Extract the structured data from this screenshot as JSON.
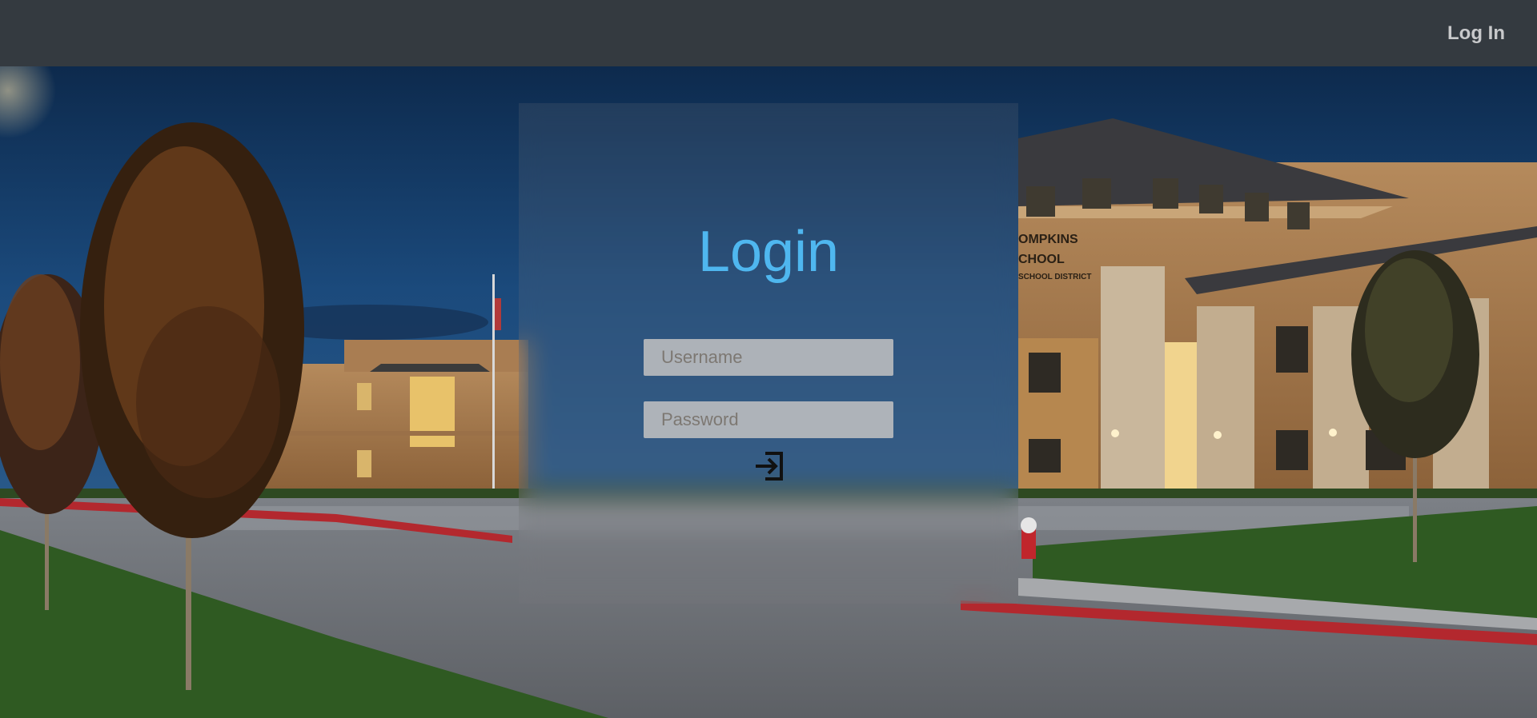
{
  "navbar": {
    "login_link": "Log In"
  },
  "background": {
    "building_sign": [
      "OMPKINS",
      "CHOOL",
      "SCHOOL DISTRICT"
    ]
  },
  "login_form": {
    "title": "Login",
    "username_placeholder": "Username",
    "password_placeholder": "Password",
    "submit_icon": "sign-in-icon"
  },
  "colors": {
    "navbar_bg": "#343a40",
    "title_color": "#4fb7ef",
    "nav_text": "#c8c9cb"
  }
}
